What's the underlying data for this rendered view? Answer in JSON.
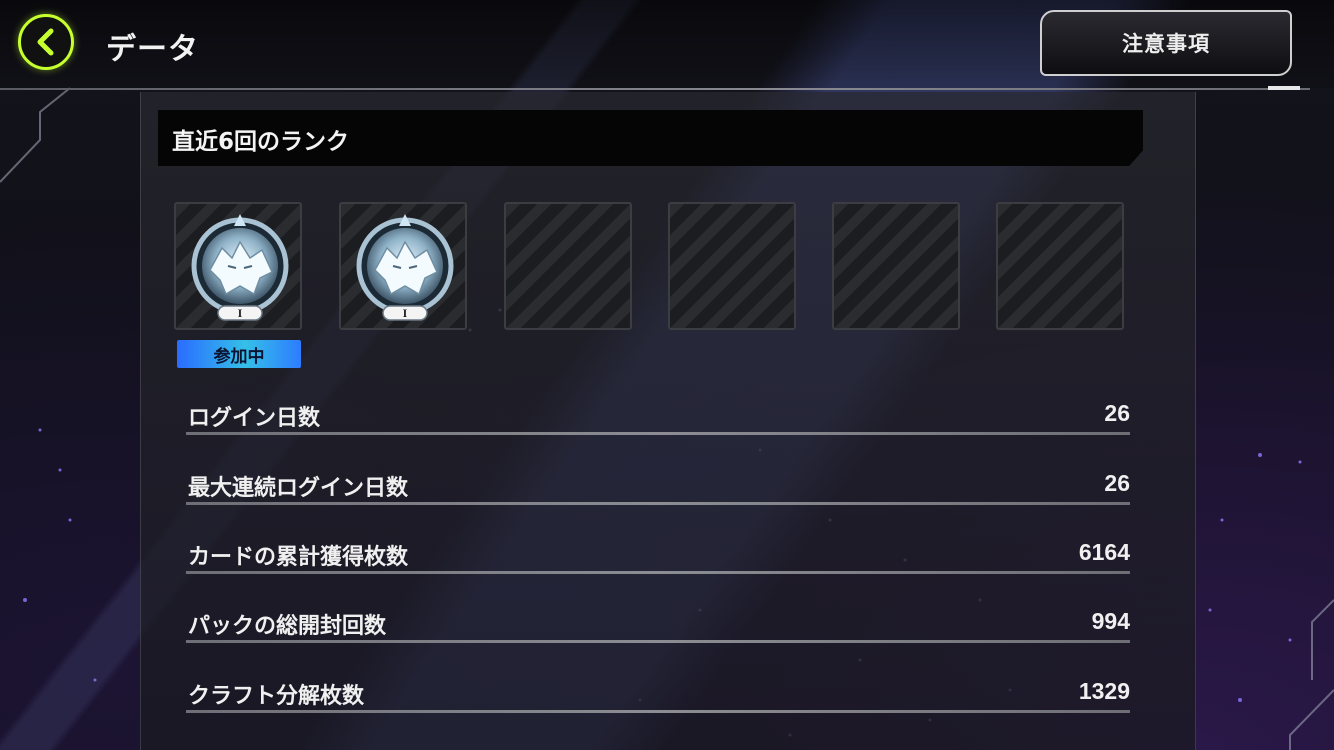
{
  "header": {
    "title": "データ",
    "notice_label": "注意事項"
  },
  "icons": {
    "back": "chevron-left-icon",
    "rank_emblem": "wolf-rank-emblem-icon"
  },
  "colors": {
    "accent": "#c6ff2e",
    "badge_gradient_start": "#2a6cff",
    "badge_gradient_mid": "#35c0e8"
  },
  "rank_section": {
    "title": "直近6回のランク",
    "slots": [
      {
        "filled": true,
        "rank_numeral": "I"
      },
      {
        "filled": true,
        "rank_numeral": "I"
      },
      {
        "filled": false
      },
      {
        "filled": false
      },
      {
        "filled": false
      },
      {
        "filled": false
      }
    ],
    "current_badge": "参加中"
  },
  "stats": [
    {
      "label": "ログイン日数",
      "value": "26"
    },
    {
      "label": "最大連続ログイン日数",
      "value": "26"
    },
    {
      "label": "カードの累計獲得枚数",
      "value": "6164"
    },
    {
      "label": "パックの総開封回数",
      "value": "994"
    },
    {
      "label": "クラフト分解枚数",
      "value": "1329"
    }
  ]
}
